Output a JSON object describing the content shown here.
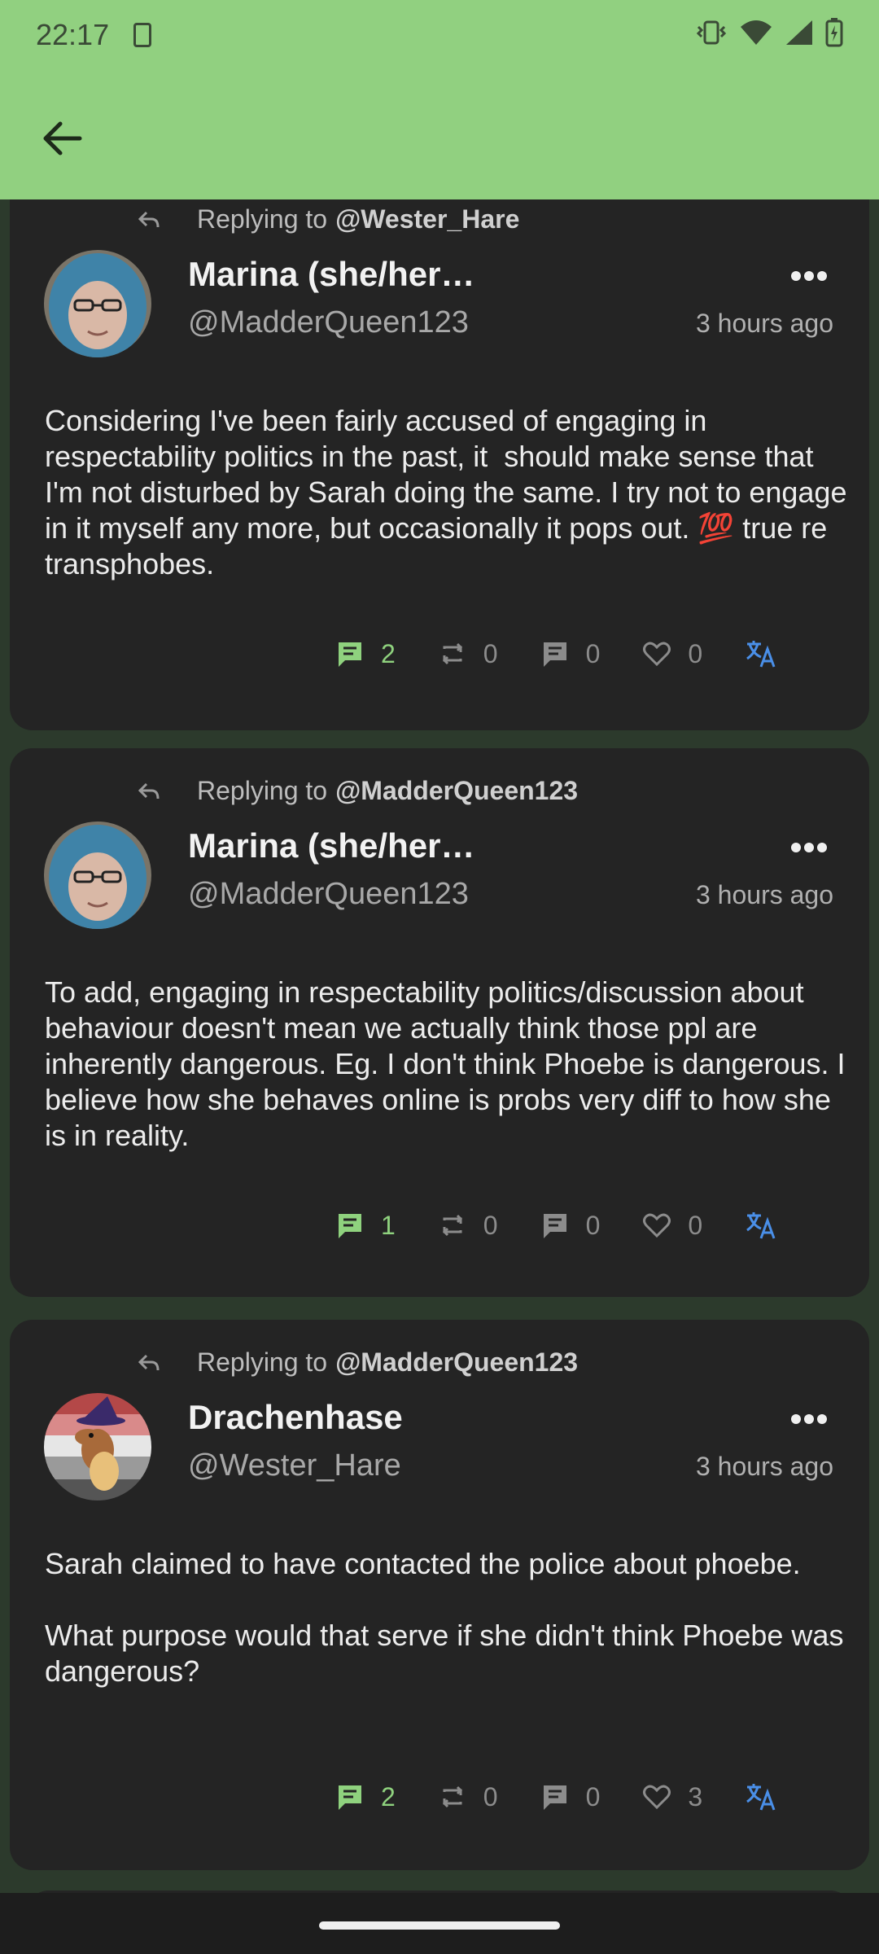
{
  "status_bar": {
    "time": "22:17"
  },
  "header": {
    "back_icon": "arrow-left-icon"
  },
  "colors": {
    "topbar": "#91d080",
    "accent_green": "#8fd27e",
    "translate_blue": "#4a8fe8",
    "card": "#242424"
  },
  "posts": [
    {
      "replying_prefix": "Replying to",
      "replying_to": "@Wester_Hare",
      "display_name": "Marina (she/her…",
      "handle": "@MadderQueen123",
      "time": "3 hours ago",
      "text": "Considering I've been fairly accused of engaging in respectability politics in the past, it  should make sense that I'm not disturbed by Sarah doing the same. I try not to engage in it myself any more, but occasionally it pops out. 💯 true re transphobes.",
      "replies": "2",
      "boosts": "0",
      "quotes": "0",
      "likes": "0"
    },
    {
      "replying_prefix": "Replying to",
      "replying_to": "@MadderQueen123",
      "display_name": "Marina (she/her…",
      "handle": "@MadderQueen123",
      "time": "3 hours ago",
      "text": "To add, engaging in respectability politics/discussion about behaviour doesn't mean we actually think those ppl are inherently dangerous. Eg. I don't think Phoebe is dangerous. I believe how she behaves online is probs very diff to how she is in reality.",
      "replies": "1",
      "boosts": "0",
      "quotes": "0",
      "likes": "0"
    },
    {
      "replying_prefix": "Replying to",
      "replying_to": "@MadderQueen123",
      "display_name": "Drachenhase",
      "handle": "@Wester_Hare",
      "time": "3 hours ago",
      "text": "Sarah claimed to have contacted the police about phoebe.\n\nWhat purpose would that serve if she didn't think Phoebe was dangerous?",
      "replies": "2",
      "boosts": "0",
      "quotes": "0",
      "likes": "3"
    }
  ]
}
